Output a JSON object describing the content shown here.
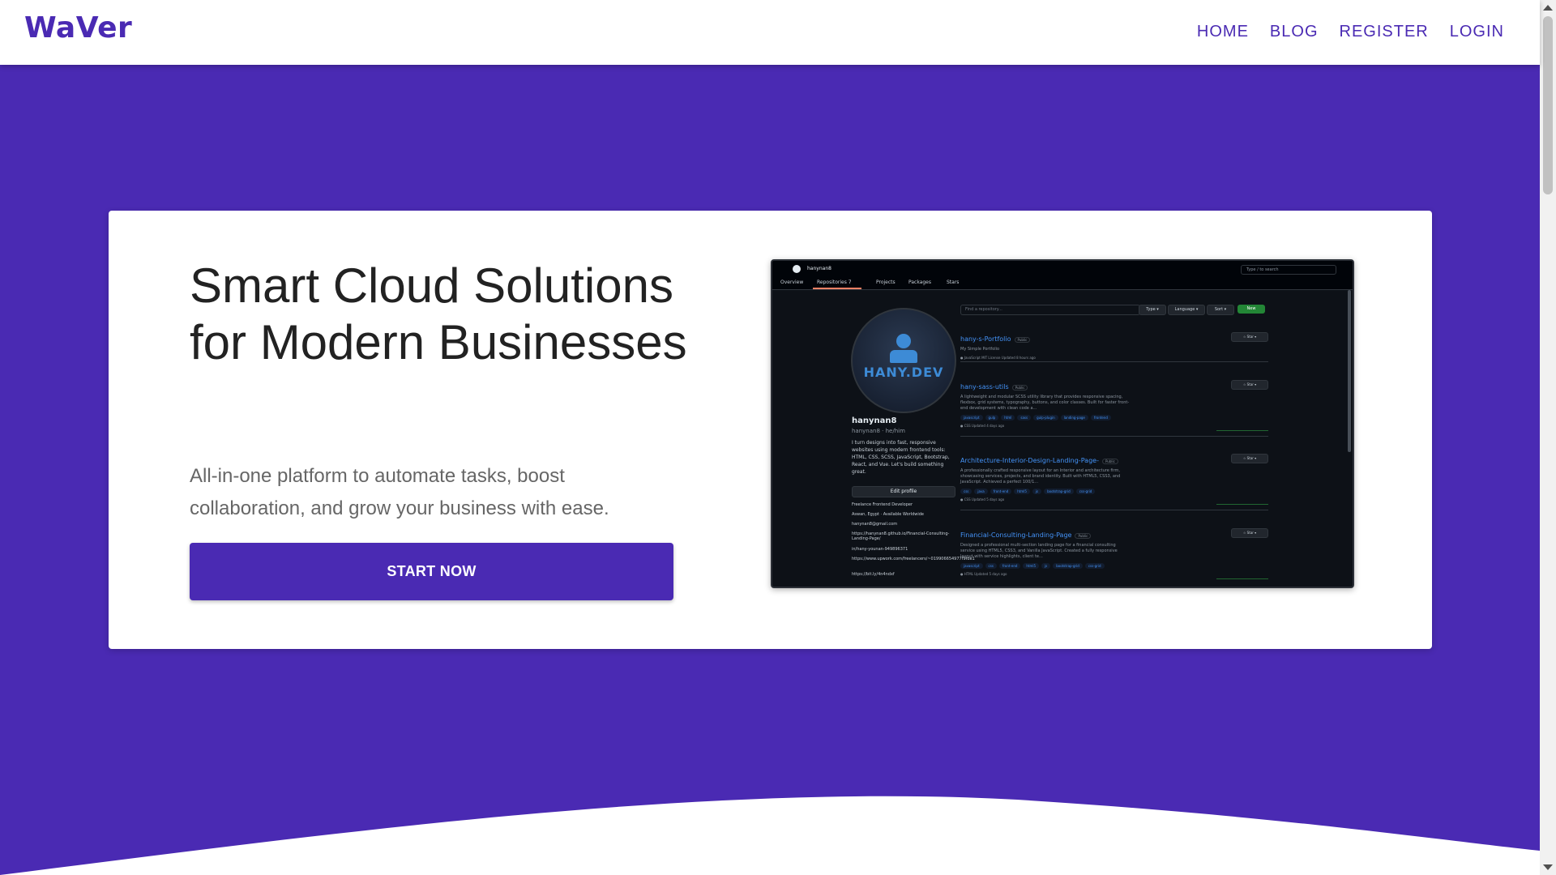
{
  "brand": "WaVer",
  "nav": {
    "items": [
      "HOME",
      "BLOG",
      "REGISTER",
      "LOGIN"
    ]
  },
  "hero": {
    "title": "Smart Cloud Solutions for Modern Businesses",
    "subtitle": "All-in-one platform to automate tasks, boost collaboration, and grow your business with ease.",
    "cta_label": "START NOW"
  },
  "preview": {
    "username_top": "hanynan8",
    "search_placeholder": "Type / to search",
    "tabs": [
      "Overview",
      "Repositories 7",
      "Projects",
      "Packages",
      "Stars"
    ],
    "avatar_text": "HANY.DEV",
    "name": "hanynan8",
    "handle": "hanynan8 · he/him",
    "bio": "I turn designs into fast, responsive websites using modern frontend tools: HTML, CSS, SCSS, JavaScript, Bootstrap, React, and Vue. Let's build something great.",
    "edit_label": "Edit profile",
    "meta": [
      "Freelance Frontend Developer",
      "Aswan, Egypt · Available Worldwide",
      "hanynan8@gmail.com",
      "https://hanynan8.github.io/Financial-Consulting-Landing-Page/",
      "in/hany-younan-949896371",
      "https://www.upwork.com/freelancers/~019906654977f9fde1",
      "https://bit.ly/4n4ndxf"
    ],
    "find_placeholder": "Find a repository...",
    "filters": {
      "type": "Type ▾",
      "language": "Language ▾",
      "sort": "Sort ▾",
      "new": "New"
    },
    "star_label": "☆ Star  ▾",
    "repos": [
      {
        "name": "hany-s-Portfolio",
        "badge": "Public",
        "desc": "My Simple Portfolio",
        "tags": [],
        "footer": "● JavaScript   MIT License   Updated 8 hours ago"
      },
      {
        "name": "hany-sass-utils",
        "badge": "Public",
        "desc": "A lightweight and modular SCSS utility library that provides responsive spacing, flexbox, grid systems, typography, buttons, and color classes. Built for faster front-end development with clean code a...",
        "tags": [
          "javascript",
          "gulp",
          "html",
          "sass",
          "gulp-plugin",
          "landing-page",
          "frontend"
        ],
        "footer": "● CSS   Updated 4 days ago"
      },
      {
        "name": "Architecture-Interior-Design-Landing-Page-",
        "badge": "Public",
        "desc": "A professionally crafted responsive layout for an Interior and architecture firm, showcasing services, projects, and brand identity. Built with HTML5, CSS3, and JavaScript. Achieved a perfect 100/1...",
        "tags": [
          "css",
          "java",
          "front-end",
          "html5",
          "js",
          "bootstrap-grid",
          "css-grid"
        ],
        "footer": "● CSS   Updated 5 days ago"
      },
      {
        "name": "Financial-Consulting-Landing-Page",
        "badge": "Public",
        "desc": "Designed a professional multi-section landing page for a financial consulting service using HTML5, CSS3, and Vanilla JavaScript. Created a fully responsive layout with service highlights, client te...",
        "tags": [
          "javascript",
          "css",
          "front-end",
          "html5",
          "js",
          "bootstrap-grid",
          "css-grid"
        ],
        "footer": "● HTML   Updated 5 days ago"
      }
    ]
  },
  "colors": {
    "primary": "#4a2ab3",
    "card": "#ffffff",
    "heading": "#222222",
    "subtext": "#666666"
  }
}
